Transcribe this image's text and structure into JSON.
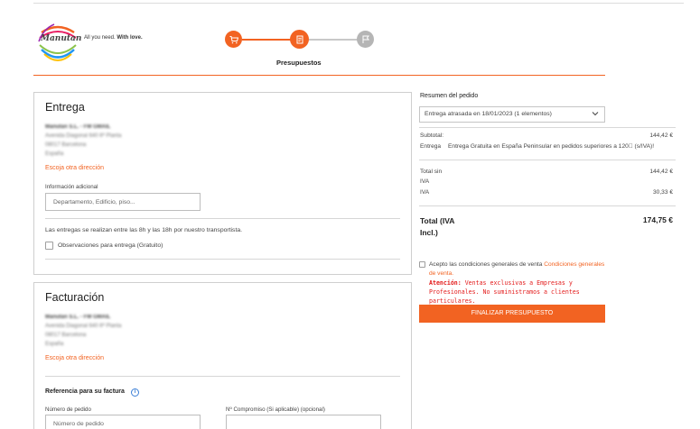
{
  "header": {
    "logo_text": "Manutan",
    "tagline_normal": "All you need. ",
    "tagline_bold": "With love.",
    "step_label": "Presupuestos",
    "steps": [
      {
        "icon": "cart-icon",
        "state": "done"
      },
      {
        "icon": "document-icon",
        "state": "active"
      },
      {
        "icon": "flag-icon",
        "state": "pending"
      }
    ],
    "colors": {
      "accent": "#f26322",
      "inactive": "#b5b5b5"
    }
  },
  "entrega": {
    "title": "Entrega",
    "address_lines": [
      "Manutan S.L. - FM GMAIL",
      "Avenida Diagonal 640 6ª Planta",
      "08017 Barcelona",
      "España"
    ],
    "change_address": "Escoja otra dirección",
    "additional_info_label": "Información adicional",
    "additional_info_placeholder": "Departamento, Edificio, piso...",
    "delivery_note": "Las entregas se realizan entre las 8h y las 18h por nuestro transportista.",
    "observations_label": "Observaciones para entrega (Gratuito)"
  },
  "facturacion": {
    "title": "Facturación",
    "address_lines": [
      "Manutan S.L. - FM GMAIL",
      "Avenida Diagonal 640 6ª Planta",
      "08017 Barcelona",
      "España"
    ],
    "change_address": "Escoja otra dirección",
    "reference_label": "Referencia para su factura",
    "order_number_label": "Número de pedido",
    "order_number_placeholder": "Número de pedido",
    "commitment_label": "Nº Compromiso (Si aplicable) (opcional)"
  },
  "summary": {
    "title": "Resumen del pedido",
    "delivery_select": "Entrega atrasada en 18/01/2023 (1 elementos)",
    "subtotal_label": "Subtotal:",
    "subtotal_value": "144,42 €",
    "delivery_label": "Entrega",
    "delivery_value": "Entrega Gratuita en España Peninsular en pedidos superiores a 120\u0000 (s/IVA)!",
    "total_sin_label": "Total sin",
    "total_sin_value": "144,42 €",
    "iva_label_1": "IVA",
    "iva_label_2": "IVA",
    "iva_value": "30,33 €",
    "total_label": "Total (IVA Incl.)",
    "total_value": "174,75 €",
    "conditions_text": "Acepto las condiciones generales de venta ",
    "conditions_link": "Condiciones generales de venta.",
    "warning_bold": "Atención:",
    "warning_text": " Ventas exclusivas a Empresas y Profesionales. No suministramos a clientes particulares.",
    "finalize_button": "FINALIZAR PRESUPUESTO"
  }
}
